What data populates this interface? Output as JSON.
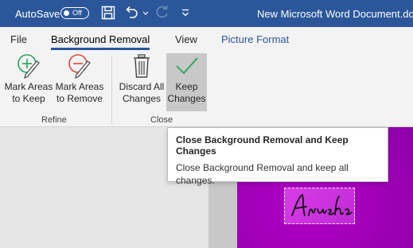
{
  "titlebar": {
    "autosave_label": "AutoSave",
    "autosave_state": "Off",
    "doc_title": "New Microsoft Word Document.docx",
    "icons": [
      "save-icon",
      "undo-icon",
      "undo-dropdown-icon",
      "redo-icon",
      "customize-quick-access-icon"
    ]
  },
  "tabs": [
    {
      "label": "File"
    },
    {
      "label": "Background Removal",
      "active": true
    },
    {
      "label": "View"
    },
    {
      "label": "Picture Format",
      "contextual": true
    }
  ],
  "groups": {
    "refine": {
      "label": "Refine",
      "buttons": [
        {
          "label_line1": "Mark Areas",
          "label_line2": "to Keep",
          "icon": "mark-keep-icon"
        },
        {
          "label_line1": "Mark Areas",
          "label_line2": "to Remove",
          "icon": "mark-remove-icon"
        }
      ]
    },
    "close": {
      "label": "Close",
      "buttons": [
        {
          "label_line1": "Discard All",
          "label_line2": "Changes",
          "icon": "trash-icon"
        },
        {
          "label_line1": "Keep",
          "label_line2": "Changes",
          "icon": "checkmark-icon"
        }
      ]
    }
  },
  "tooltip": {
    "title": "Close Background Removal and Keep Changes",
    "body": "Close Background Removal and keep all changes."
  },
  "document": {
    "signature_text": "Anusha"
  },
  "colors": {
    "titlebar": "#2b579a",
    "ribbon": "#f3f3f3",
    "image_magenta": "#a100b8",
    "keep_green": "#22a65c",
    "remove_red": "#e0443c"
  }
}
